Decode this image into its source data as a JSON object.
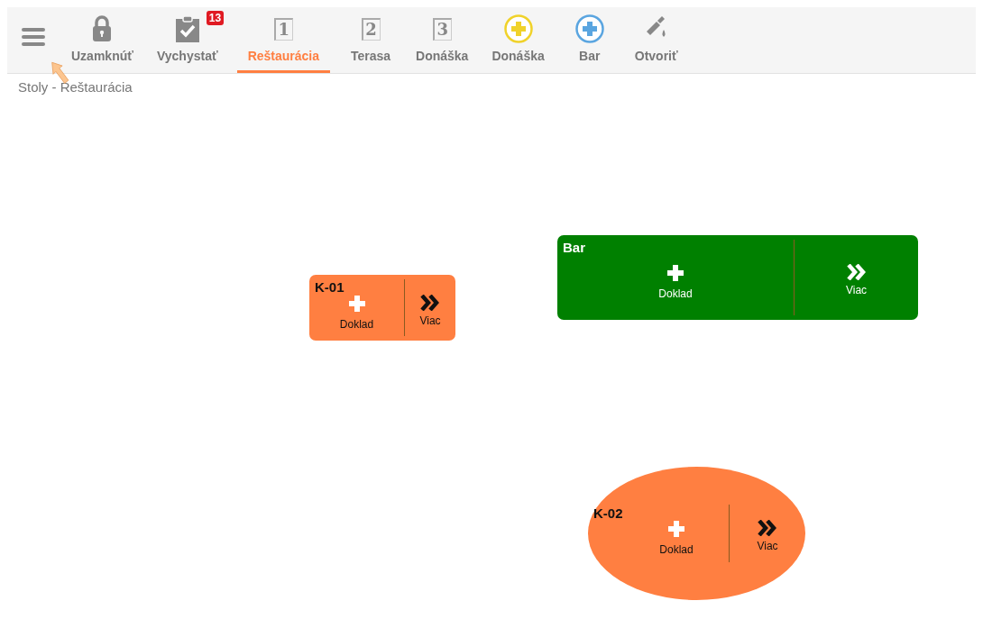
{
  "toolbar": [
    {
      "kind": "lock",
      "label": "Uzamknúť",
      "selected": false
    },
    {
      "kind": "clipboard",
      "label": "Vychystať",
      "badge": "13",
      "selected": false
    },
    {
      "kind": "number",
      "number": "1",
      "label": "Reštaurácia",
      "selected": true
    },
    {
      "kind": "number",
      "number": "2",
      "label": "Terasa",
      "selected": false
    },
    {
      "kind": "number",
      "number": "3",
      "label": "Donáška",
      "selected": false
    },
    {
      "kind": "plus",
      "color": "#f0d22a",
      "label": "Donáška",
      "selected": false
    },
    {
      "kind": "plus",
      "color": "#5aa5e0",
      "label": "Bar",
      "selected": false
    },
    {
      "kind": "bottle",
      "label": "Otvoriť",
      "selected": false
    }
  ],
  "breadcrumb": "Stoly - Reštaurácia",
  "tables": [
    {
      "name": "K-01",
      "kind": "rect",
      "color": "#ff7f41",
      "action": "Doklad",
      "more": "Viac"
    },
    {
      "name": "Bar",
      "kind": "rect",
      "color": "#008000",
      "action": "Doklad",
      "more": "Viac"
    },
    {
      "name": "K-02",
      "kind": "ellipse",
      "color": "#ff7f41",
      "action": "Doklad",
      "more": "Viac"
    }
  ]
}
